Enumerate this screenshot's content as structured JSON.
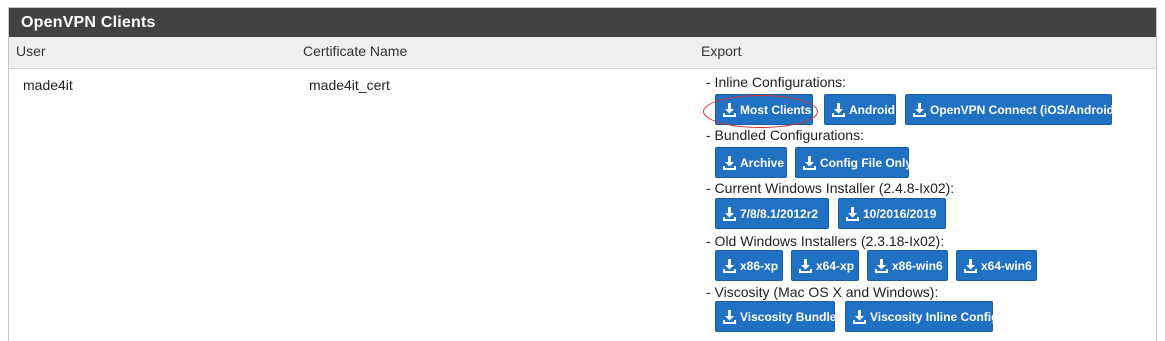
{
  "panel": {
    "title": "OpenVPN Clients"
  },
  "columns": {
    "user": "User",
    "certificate": "Certificate Name",
    "export": "Export"
  },
  "row": {
    "user": "made4it",
    "certificate": "made4it_cert"
  },
  "export": {
    "inline_label": "- Inline Configurations:",
    "inline_buttons": [
      "Most Clients",
      "Android",
      "OpenVPN Connect (iOS/Android)"
    ],
    "bundled_label": "- Bundled Configurations:",
    "bundled_buttons": [
      "Archive",
      "Config File Only"
    ],
    "current_win_label": "- Current Windows Installer (2.4.8-Ix02):",
    "current_win_buttons": [
      "7/8/8.1/2012r2",
      "10/2016/2019"
    ],
    "old_win_label": "- Old Windows Installers (2.3.18-Ix02):",
    "old_win_buttons": [
      "x86-xp",
      "x64-xp",
      "x86-win6",
      "x64-win6"
    ],
    "viscosity_label": "- Viscosity (Mac OS X and Windows):",
    "viscosity_buttons": [
      "Viscosity Bundle",
      "Viscosity Inline Config"
    ]
  },
  "icons": {
    "download": "download-icon"
  },
  "colors": {
    "button": "#2071c4",
    "heading": "#424242",
    "highlight_circle": "#d6312a"
  }
}
